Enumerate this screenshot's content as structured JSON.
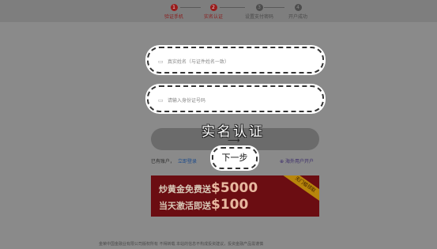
{
  "steps": [
    {
      "num": "1",
      "label": "验证手机",
      "active": true
    },
    {
      "num": "2",
      "label": "实名认证",
      "active": true
    },
    {
      "num": "3",
      "label": "设置支付密码",
      "active": false
    },
    {
      "num": "4",
      "label": "开户成功",
      "active": false
    }
  ],
  "form": {
    "name_placeholder": "真实姓名（与证件姓名一致）",
    "id_placeholder": "请输入身份证号码"
  },
  "title_text": "实名认证",
  "next_button": "下一步",
  "account": {
    "prompt": "已有账户，",
    "login_link": "立即登录"
  },
  "overseas_link": "海外用户开户",
  "banner": {
    "line1_prefix": "炒黄金免费送",
    "line1_amount": "$5000",
    "line2_prefix": "当天激活即送",
    "line2_amount": "$100",
    "ribbon": "无门槛领取"
  },
  "footer": "金荣中国金融业有限公司版权所有  不得转载  本站的信息不构成投资建议，投资金融产品需谨慎"
}
